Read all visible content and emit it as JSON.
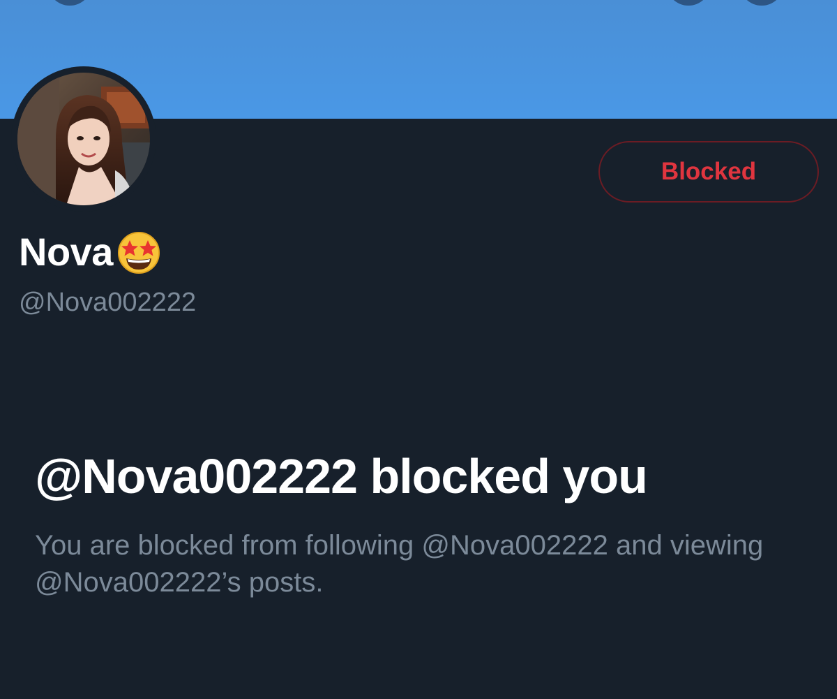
{
  "profile": {
    "display_name": "Nova",
    "handle": "@Nova002222",
    "block_button_label": "Blocked",
    "avatar_alt": "profile-photo"
  },
  "block_notice": {
    "headline": "@Nova002222 blocked you",
    "message": "You are blocked from following @Nova002222 and viewing @Nova002222’s posts."
  },
  "colors": {
    "banner": "#4a98e6",
    "background": "#17202b",
    "blocked_text": "#e0353f",
    "blocked_border": "#6b1c24",
    "secondary_text": "#7c8a99"
  },
  "icons": {
    "name_emoji": "star-struck-emoji-icon",
    "back": "back-arrow-icon",
    "search": "search-icon",
    "more": "more-options-icon"
  }
}
